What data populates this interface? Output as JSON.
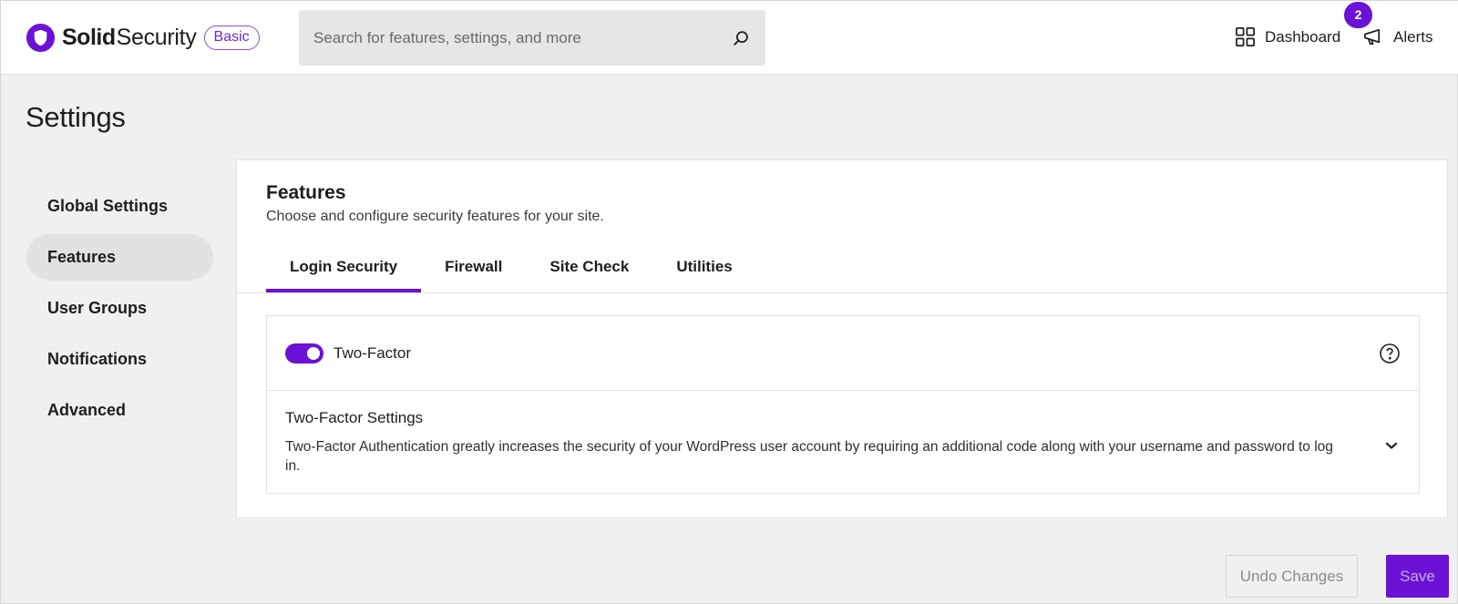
{
  "header": {
    "brand_bold": "Solid",
    "brand_regular": "Security",
    "plan_badge": "Basic",
    "search_placeholder": "Search for features, settings, and more",
    "dashboard_label": "Dashboard",
    "alerts_label": "Alerts",
    "alerts_count": "2"
  },
  "page": {
    "title": "Settings"
  },
  "sidebar": {
    "items": [
      {
        "label": "Global Settings",
        "active": false
      },
      {
        "label": "Features",
        "active": true
      },
      {
        "label": "User Groups",
        "active": false
      },
      {
        "label": "Notifications",
        "active": false
      },
      {
        "label": "Advanced",
        "active": false
      }
    ]
  },
  "panel": {
    "title": "Features",
    "description": "Choose and configure security features for your site.",
    "tabs": [
      {
        "label": "Login Security",
        "active": true
      },
      {
        "label": "Firewall",
        "active": false
      },
      {
        "label": "Site Check",
        "active": false
      },
      {
        "label": "Utilities",
        "active": false
      }
    ],
    "feature": {
      "toggle_label": "Two-Factor",
      "enabled": true,
      "settings_title": "Two-Factor Settings",
      "settings_description": "Two-Factor Authentication greatly increases the security of your WordPress user account by requiring an additional code along with your username and password to log in."
    }
  },
  "footer": {
    "undo_label": "Undo Changes",
    "save_label": "Save"
  },
  "colors": {
    "accent": "#6b12d6",
    "badge_border": "#8a4fd8",
    "background": "#f0f0f0"
  }
}
